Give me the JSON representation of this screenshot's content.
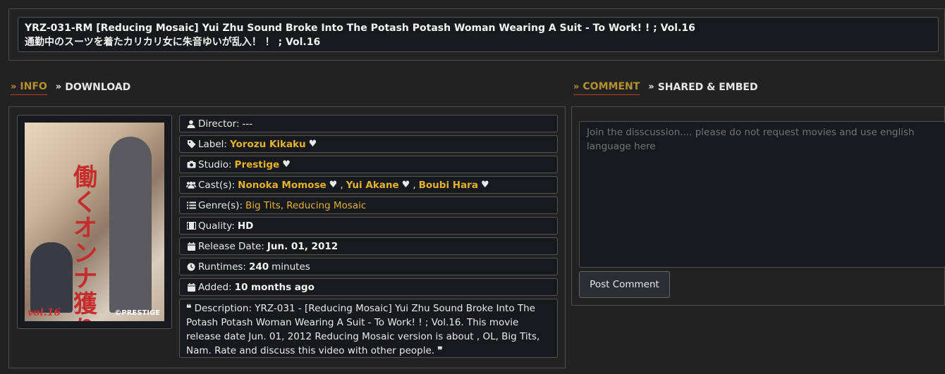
{
  "title": {
    "line1": "YRZ-031-RM [Reducing Mosaic] Yui Zhu Sound Broke Into The Potash Potash Woman Wearing A Suit - To Work! ! ; Vol.16",
    "line2": "通勤中のスーツを着たカリカリ女に朱音ゆいが乱入！ ！ ; Vol.16"
  },
  "left_tabs": [
    {
      "label": "INFO",
      "active": true
    },
    {
      "label": "DOWNLOAD",
      "active": false
    }
  ],
  "right_tabs": [
    {
      "label": "COMMENT",
      "active": true
    },
    {
      "label": "SHARED & EMBED",
      "active": false
    }
  ],
  "poster": {
    "big_text": "働くオンナ獲り",
    "vol_text": "vol.16",
    "brand_text": "©PRESTIGE"
  },
  "info": {
    "director": {
      "label": "Director:",
      "value": "---",
      "icon": "user-icon"
    },
    "label": {
      "label": "Label:",
      "value": "Yorozu Kikaku",
      "icon": "tag-icon"
    },
    "studio": {
      "label": "Studio:",
      "value": "Prestige",
      "icon": "camera-icon"
    },
    "cast": {
      "label": "Cast(s):",
      "values": [
        "Nonoka Momose",
        "Yui Akane",
        "Boubi Hara"
      ],
      "separator": ",",
      "icon": "users-icon"
    },
    "genre": {
      "label": "Genre(s):",
      "values": [
        "Big Tits",
        "Reducing Mosaic"
      ],
      "separator": ",",
      "icon": "list-icon"
    },
    "quality": {
      "label": "Quality:",
      "value": "HD",
      "icon": "film-icon"
    },
    "release": {
      "label": "Release Date:",
      "value": "Jun. 01, 2012",
      "icon": "calendar-icon"
    },
    "runtime": {
      "label": "Runtimes:",
      "value": "240",
      "suffix": "minutes",
      "icon": "clock-icon"
    },
    "added": {
      "label": "Added:",
      "value": "10 months ago",
      "icon": "calendar-icon"
    },
    "description": {
      "label": "Description:",
      "text": "YRZ-031 - [Reducing Mosaic] Yui Zhu Sound Broke Into The Potash Potash Woman Wearing A Suit - To Work! ! ; Vol.16. This movie release date Jun. 01, 2012 Reducing Mosaic version is about , OL, Big Tits, Nam. Rate and discuss this video with other people.",
      "icon": "quote-icon"
    }
  },
  "comment": {
    "placeholder": "Join the disscussion.... please do not request movies and use english language here",
    "button_label": "Post Comment"
  },
  "colors": {
    "accent": "#e5b22c",
    "tab_active": "#b5902c",
    "background": "#222222",
    "field_bg": "#17191d"
  }
}
